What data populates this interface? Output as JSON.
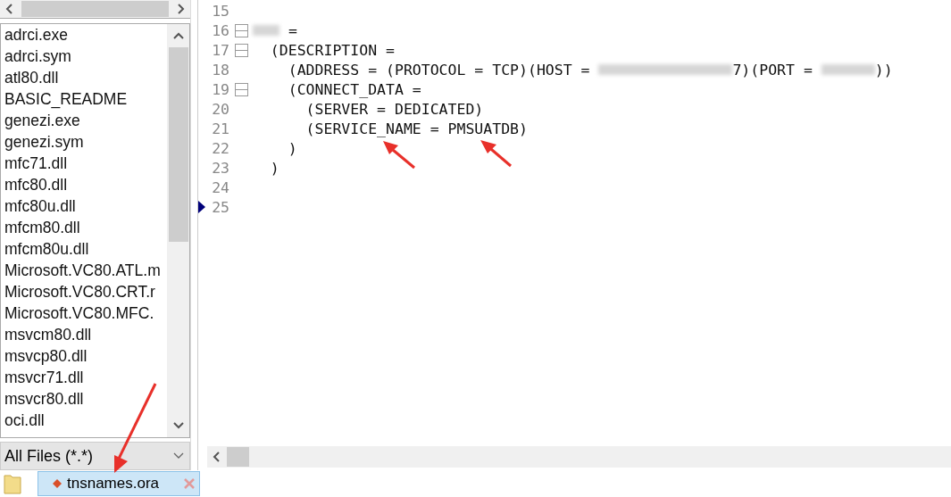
{
  "file_list": {
    "items": [
      {
        "name": "adrci.exe",
        "selected": false
      },
      {
        "name": "adrci.sym",
        "selected": false
      },
      {
        "name": "atl80.dll",
        "selected": false
      },
      {
        "name": "BASIC_README",
        "selected": false
      },
      {
        "name": "genezi.exe",
        "selected": false
      },
      {
        "name": "genezi.sym",
        "selected": false
      },
      {
        "name": "mfc71.dll",
        "selected": false
      },
      {
        "name": "mfc80.dll",
        "selected": false
      },
      {
        "name": "mfc80u.dll",
        "selected": false
      },
      {
        "name": "mfcm80.dll",
        "selected": false
      },
      {
        "name": "mfcm80u.dll",
        "selected": false
      },
      {
        "name": "Microsoft.VC80.ATL.m",
        "selected": false
      },
      {
        "name": "Microsoft.VC80.CRT.r",
        "selected": false
      },
      {
        "name": "Microsoft.VC80.MFC.",
        "selected": false
      },
      {
        "name": "msvcm80.dll",
        "selected": false
      },
      {
        "name": "msvcp80.dll",
        "selected": false
      },
      {
        "name": "msvcr71.dll",
        "selected": false
      },
      {
        "name": "msvcr80.dll",
        "selected": false
      },
      {
        "name": "oci.dll",
        "selected": false
      }
    ]
  },
  "filter": {
    "value": "All Files (*.*)"
  },
  "tabs": [
    {
      "label": "tnsnames.ora",
      "selected": true
    }
  ],
  "editor": {
    "lines": [
      {
        "number": "15",
        "fold": false,
        "current": false
      },
      {
        "number": "16",
        "fold": true,
        "current": false,
        "segments": [
          {
            "kind": "redacted"
          },
          {
            "kind": "text",
            "text": " ="
          }
        ]
      },
      {
        "number": "17",
        "fold": true,
        "current": false,
        "segments": [
          {
            "kind": "text",
            "text": "  (DESCRIPTION ="
          }
        ]
      },
      {
        "number": "18",
        "fold": false,
        "current": false,
        "segments": [
          {
            "kind": "text",
            "text": "    (ADDRESS = (PROTOCOL = TCP)(HOST = "
          },
          {
            "kind": "redacted"
          },
          {
            "kind": "text",
            "text": "7)(PORT = "
          },
          {
            "kind": "redacted"
          },
          {
            "kind": "text",
            "text": "))"
          }
        ]
      },
      {
        "number": "19",
        "fold": true,
        "current": false,
        "segments": [
          {
            "kind": "text",
            "text": "    (CONNECT_DATA ="
          }
        ]
      },
      {
        "number": "20",
        "fold": false,
        "current": false,
        "segments": [
          {
            "kind": "text",
            "text": "      (SERVER = DEDICATED)"
          }
        ]
      },
      {
        "number": "21",
        "fold": false,
        "current": false,
        "segments": [
          {
            "kind": "text",
            "text": "      (SERVICE_NAME = PMSUATDB)"
          }
        ]
      },
      {
        "number": "22",
        "fold": false,
        "current": false,
        "segments": [
          {
            "kind": "text",
            "text": "    )"
          }
        ]
      },
      {
        "number": "23",
        "fold": false,
        "current": false,
        "segments": [
          {
            "kind": "text",
            "text": "  )"
          }
        ]
      },
      {
        "number": "24",
        "fold": false,
        "current": false
      },
      {
        "number": "25",
        "fold": false,
        "current": true
      }
    ]
  }
}
